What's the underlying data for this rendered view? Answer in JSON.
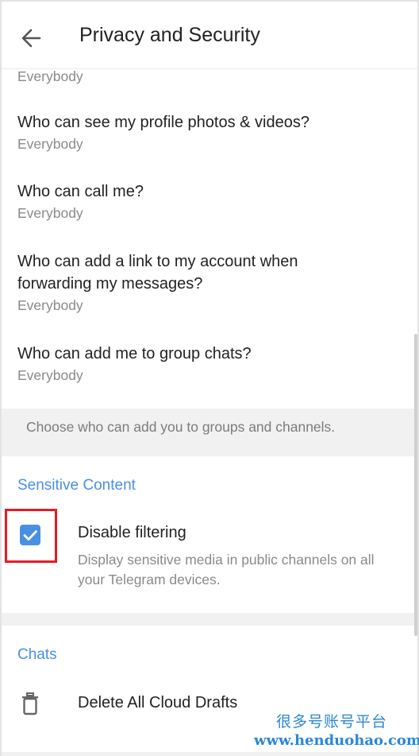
{
  "header": {
    "title": "Privacy and Security"
  },
  "privacy_items": [
    {
      "sub": "Everybody"
    },
    {
      "title": "Who can see my profile photos & videos?",
      "sub": "Everybody"
    },
    {
      "title": "Who can call me?",
      "sub": "Everybody"
    },
    {
      "title": "Who can add a link to my account when forwarding my messages?",
      "sub": "Everybody"
    },
    {
      "title": "Who can add me to group chats?",
      "sub": "Everybody"
    }
  ],
  "groups_hint": "Choose who can add you to groups and channels.",
  "sensitive": {
    "heading": "Sensitive Content",
    "disable_filtering": {
      "label": "Disable filtering",
      "description": "Display sensitive media in public channels on all your Telegram devices.",
      "checked": true
    }
  },
  "chats": {
    "heading": "Chats",
    "delete_drafts": "Delete All Cloud Drafts"
  },
  "watermark": {
    "line1": "很多号账号平台",
    "line2": "www.henduohao.com"
  },
  "colors": {
    "accent": "#4a90e2",
    "highlight": "#e31c25",
    "band": "#f1f1f1"
  }
}
